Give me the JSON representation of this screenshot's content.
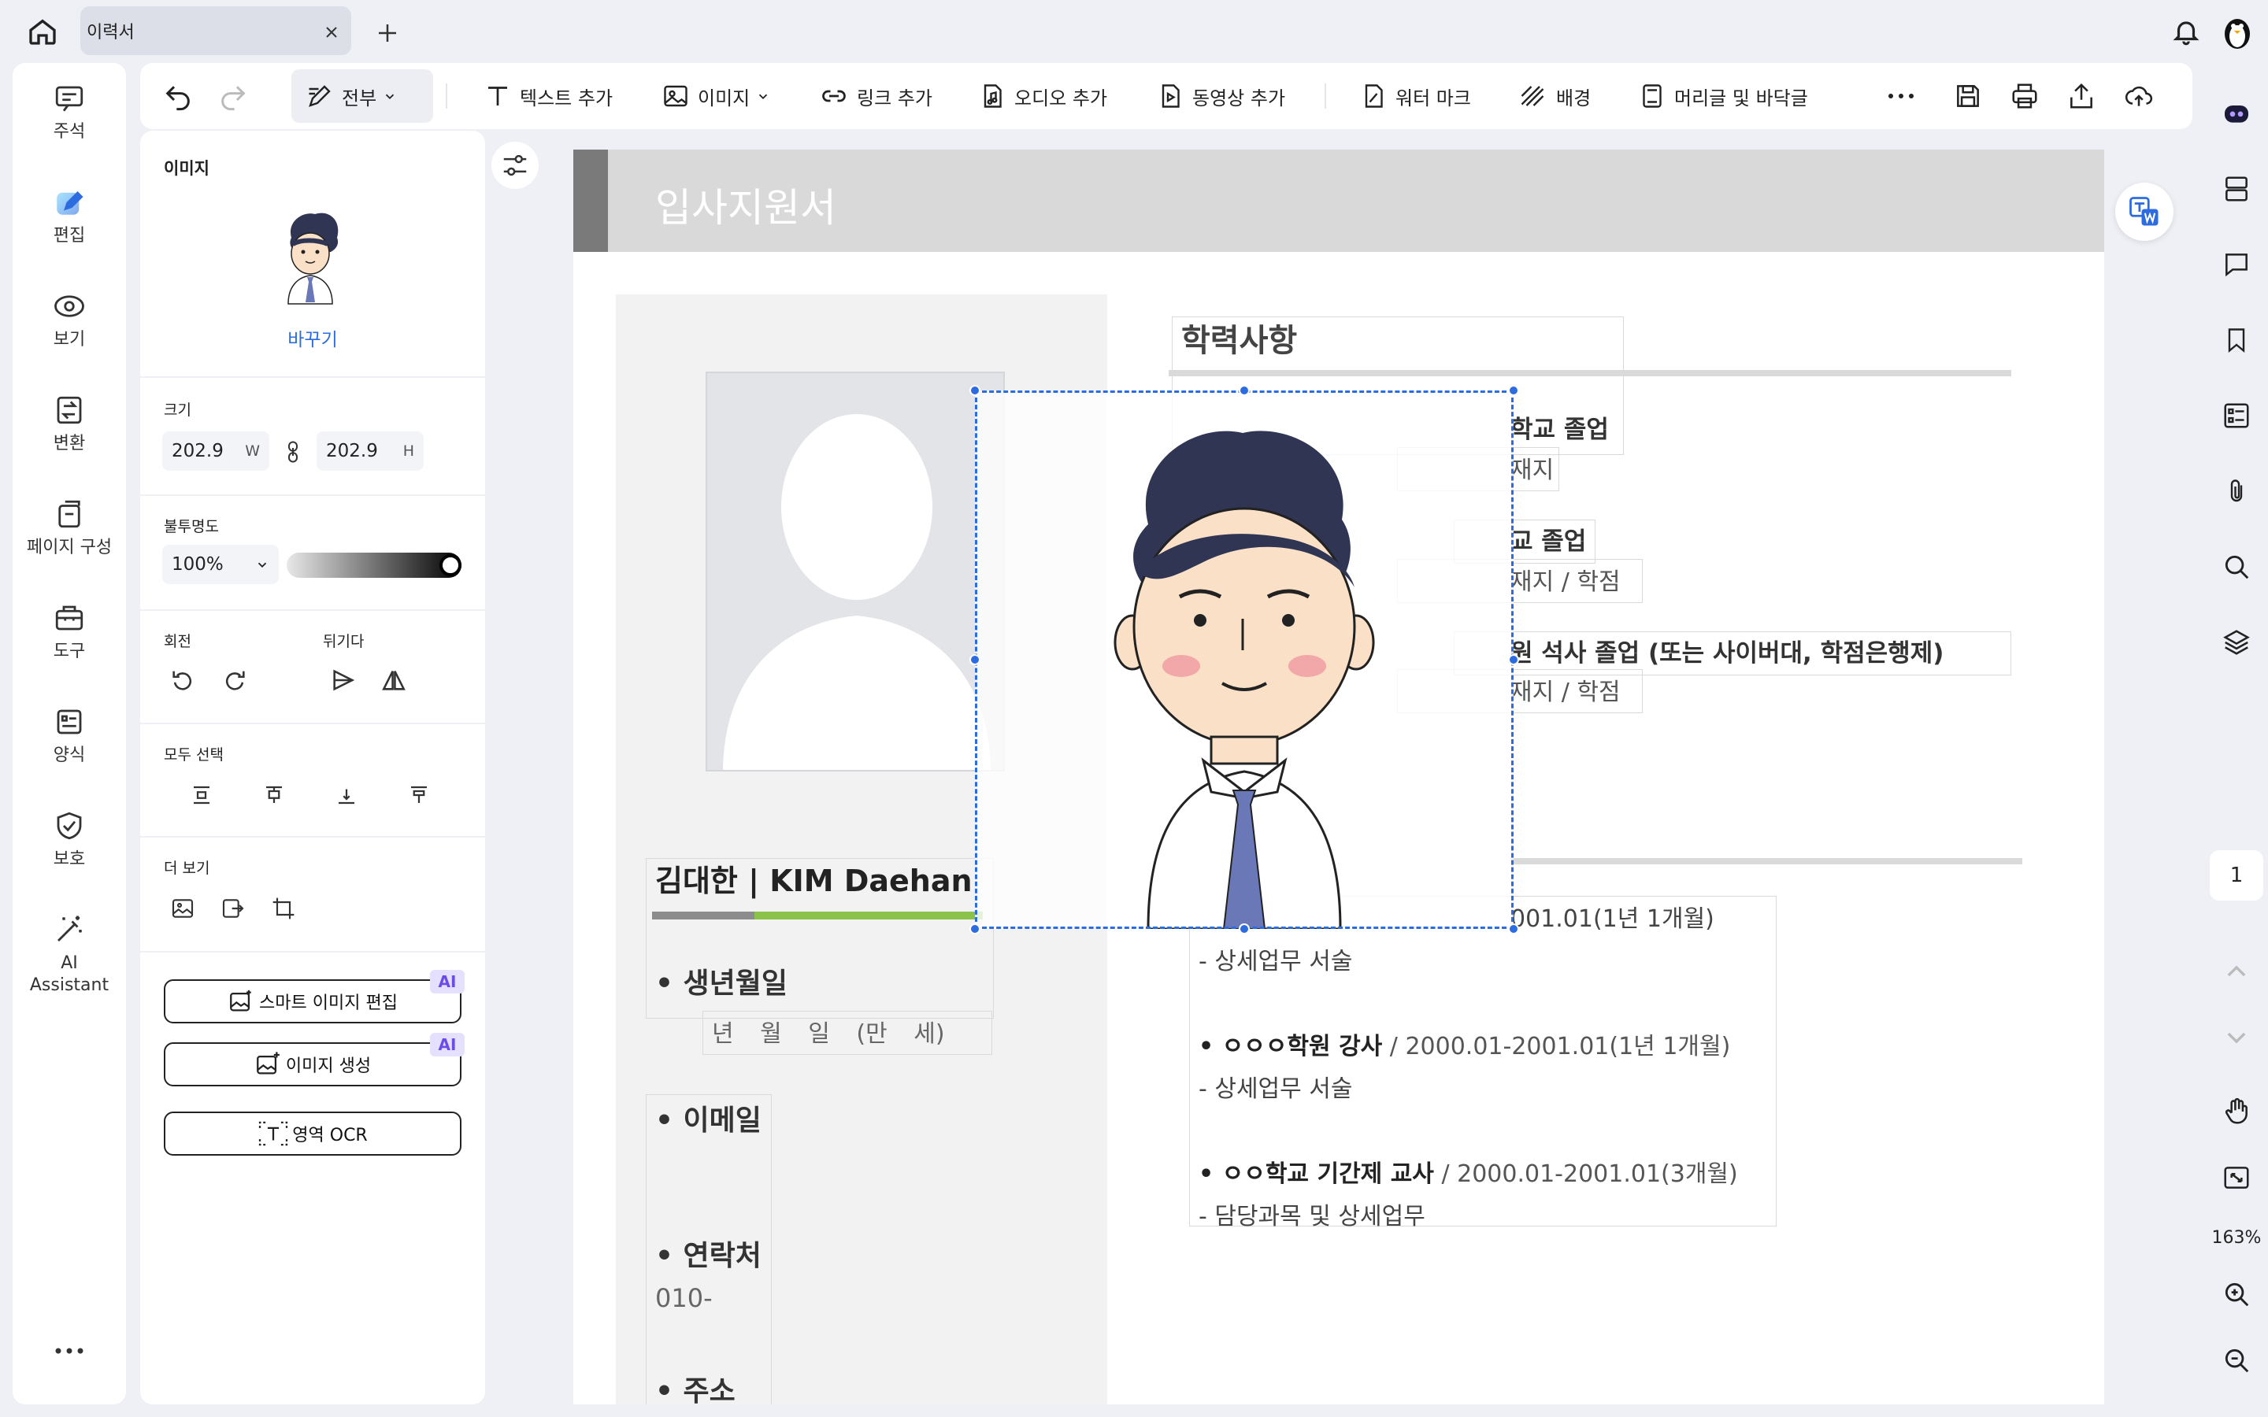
{
  "tab": {
    "title": "이력서"
  },
  "left_nav": [
    {
      "label": "주석",
      "icon": "comment-icon"
    },
    {
      "label": "편집",
      "icon": "edit-pen-icon"
    },
    {
      "label": "보기",
      "icon": "eye-icon"
    },
    {
      "label": "변환",
      "icon": "convert-icon"
    },
    {
      "label": "페이지 구성",
      "icon": "page-organize-icon"
    },
    {
      "label": "도구",
      "icon": "toolbox-icon"
    },
    {
      "label": "양식",
      "icon": "form-icon"
    },
    {
      "label": "보호",
      "icon": "shield-icon"
    },
    {
      "label": "AI Assistant",
      "icon": "magic-wand-icon"
    }
  ],
  "toolbar": {
    "mode_label": "전부",
    "add_text": "텍스트 추가",
    "image": "이미지",
    "add_link": "링크 추가",
    "add_audio": "오디오 추가",
    "add_video": "동영상 추가",
    "watermark": "워터 마크",
    "background": "배경",
    "header_footer": "머리글 및 바닥글"
  },
  "panel": {
    "image_title": "이미지",
    "replace": "바꾸기",
    "size_title": "크기",
    "width": "202.9",
    "width_unit": "W",
    "height": "202.9",
    "height_unit": "H",
    "opacity_title": "불투명도",
    "opacity_value": "100%",
    "opacity_level": 1.0,
    "rotate_title": "회전",
    "flip_title": "뒤기다",
    "align_title": "모두 선택",
    "more_title": "더 보기",
    "smart_edit": "스마트 이미지 편집",
    "generate": "이미지 생성",
    "ocr": "영역 OCR",
    "ai_badge": "AI"
  },
  "doc": {
    "title": "입사지원서",
    "edu_heading": "학력사항",
    "edu1": "학교 졸업",
    "edu1_sub": "재지",
    "edu2": "교 졸업",
    "edu2_sub": "재지 / 학점",
    "edu3": "원 석사 졸업 (또는 사이버대, 학점은행제)",
    "edu3_sub": "재지 / 학점",
    "name": "김대한 | KIM Daehan",
    "birth_label": "• 생년월일",
    "birth_value": "년 월 일 (만 세)",
    "email_label": "• 이메일",
    "contact_label": "• 연락처",
    "contact_value": "010-",
    "address_label": "• 주소",
    "career_period1": "001.01(1년 1개월)",
    "career_detail1": "- 상세업무 서술",
    "career2_title": "• ㅇㅇㅇ학원 강사",
    "career2_period": " / 2000.01-2001.01(1년 1개월)",
    "career_detail2": "- 상세업무 서술",
    "career3_title": "• ㅇㅇ학교 기간제 교사",
    "career3_period": " / 2000.01-2001.01(3개월)",
    "career_detail3": "- 담당과목 및 상세업무"
  },
  "right_bar": {
    "page": "1",
    "zoom": "163%"
  },
  "colors": {
    "accent": "#2d6cdf",
    "ai_purple": "#6b4ce6",
    "name_bar_green": "#8bc34a",
    "header_gray": "#d9d9d9"
  }
}
